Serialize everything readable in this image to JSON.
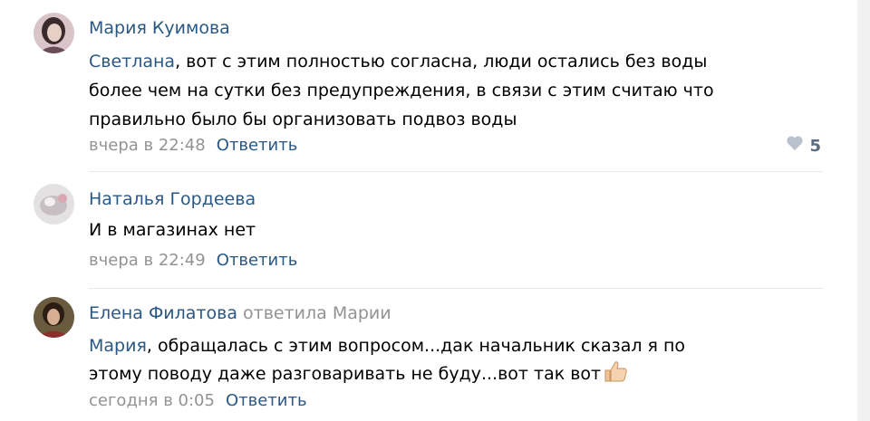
{
  "comments": [
    {
      "author": "Мария Куимова",
      "reply_to": "",
      "text_lines": [
        {
          "mention": "Светлана",
          "rest": ", вот с этим полностью согласна, люди остались без воды"
        },
        {
          "mention": "",
          "rest": "более чем на сутки без предупреждения, в связи с этим считаю что"
        },
        {
          "mention": "",
          "rest": "правильно было бы организовать подвоз воды"
        }
      ],
      "date": "вчера в 22:48",
      "reply_label": "Ответить",
      "likes": "5"
    },
    {
      "author": "Наталья Гордеева",
      "reply_to": "",
      "text_lines": [
        {
          "mention": "",
          "rest": "И в магазинах нет"
        }
      ],
      "date": "вчера в 22:49",
      "reply_label": "Ответить"
    },
    {
      "author": "Елена Филатова",
      "reply_to": "ответила Марии",
      "text_lines": [
        {
          "mention": "Мария",
          "rest": ", обращалась с этим вопросом...дак начальник сказал я по"
        },
        {
          "mention": "",
          "rest": "этому поводу даже разговаривать не буду...вот так вот"
        }
      ],
      "date": "сегодня в 0:05",
      "reply_label": "Ответить"
    }
  ],
  "icons": {
    "like": "heart-icon",
    "emoji": "thumbs-up-icon"
  },
  "colors": {
    "link": "#2a5885",
    "muted": "#939393",
    "divider": "#e7e8ec",
    "like_count": "#5a6b7d"
  }
}
